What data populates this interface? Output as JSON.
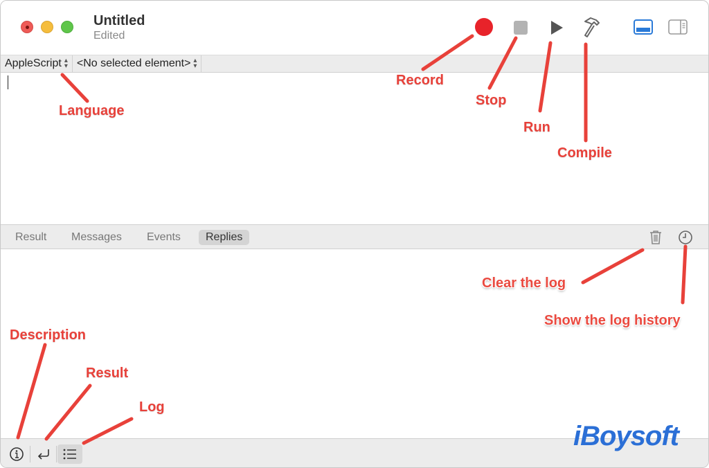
{
  "window": {
    "title": "Untitled",
    "subtitle": "Edited"
  },
  "toolbar": {
    "record": "record-icon",
    "stop": "stop-icon",
    "run": "play-icon",
    "compile": "hammer-icon",
    "view_log": "bottom-pane-icon",
    "view_sidebar": "sidebar-icon",
    "record_color": "#e8232a"
  },
  "navbar": {
    "language": "AppleScript",
    "element": "<No selected element>"
  },
  "editor": {
    "content": ""
  },
  "log": {
    "tabs": [
      {
        "label": "Result",
        "active": false
      },
      {
        "label": "Messages",
        "active": false
      },
      {
        "label": "Events",
        "active": false
      },
      {
        "label": "Replies",
        "active": true
      }
    ],
    "clear_icon": "trash-icon",
    "history_icon": "clock-icon"
  },
  "bottom": {
    "description_icon": "info-icon",
    "result_icon": "return-arrow-icon",
    "log_icon": "list-icon"
  },
  "annotations": {
    "record": "Record",
    "stop": "Stop",
    "run": "Run",
    "compile": "Compile",
    "language": "Language",
    "clear_log": "Clear the log",
    "show_history": "Show the log history",
    "description": "Description",
    "result": "Result",
    "log": "Log",
    "color": "#e8413a"
  },
  "watermark": "iBoysoft"
}
